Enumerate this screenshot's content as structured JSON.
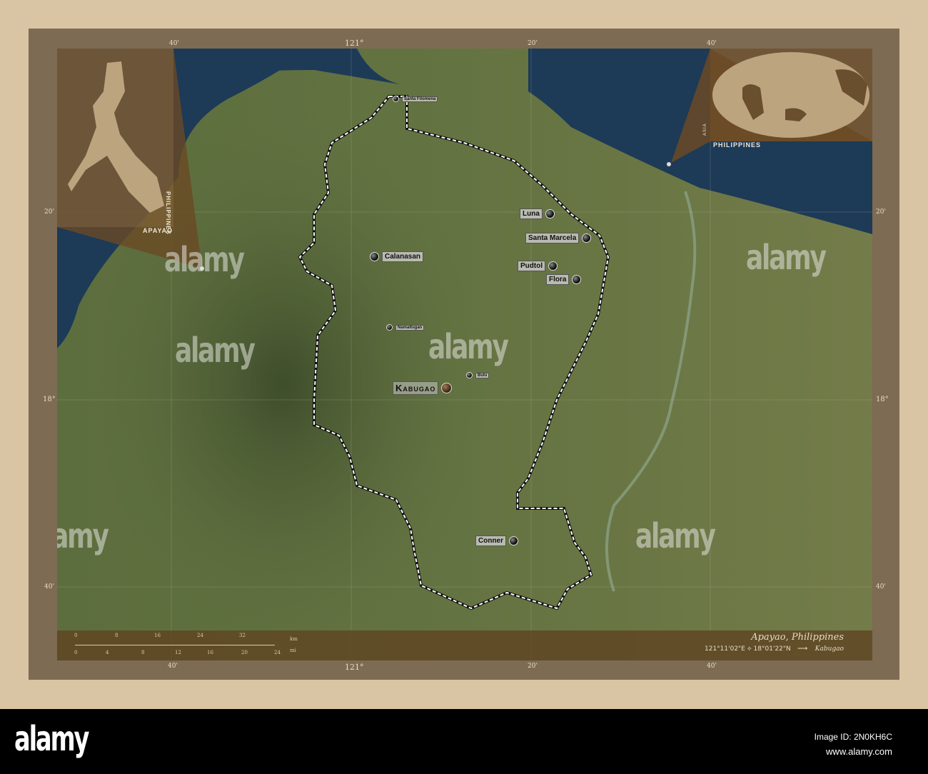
{
  "map": {
    "title": "Apayao, Philippines",
    "capital_coords": "121°11'02\"E ⟡ 18°01'22\"N",
    "arrow": "⟶",
    "capital_name": "Kabugao",
    "grid_ticks": {
      "top": [
        "40'",
        "121°",
        "20'",
        "40'"
      ],
      "bottom": [
        "40'",
        "121°",
        "20'",
        "40'"
      ],
      "left": [
        "20'",
        "18°",
        "40'"
      ],
      "right": [
        "20'",
        "18°",
        "40'"
      ]
    },
    "places": [
      {
        "name": "Santa Filomena",
        "size": "small"
      },
      {
        "name": "Luna",
        "size": "normal"
      },
      {
        "name": "Santa Marcela",
        "size": "normal"
      },
      {
        "name": "Calanasan",
        "size": "normal"
      },
      {
        "name": "Pudtol",
        "size": "normal"
      },
      {
        "name": "Flora",
        "size": "normal"
      },
      {
        "name": "Namaltugan",
        "size": "small"
      },
      {
        "name": "Bulu",
        "size": "small"
      },
      {
        "name": "Kabugao",
        "size": "capital"
      },
      {
        "name": "Conner",
        "size": "normal"
      }
    ],
    "inset_country": {
      "country_label": "Philippines",
      "region_label": "Apayao"
    },
    "inset_world": {
      "country_label": "Philippines",
      "continent_label": "Asia"
    },
    "scale": {
      "km_unit": "km",
      "mi_unit": "mi",
      "km_ticks": [
        "0",
        "8",
        "16",
        "24",
        "32"
      ],
      "mi_ticks": [
        "0",
        "4",
        "8",
        "12",
        "16",
        "20",
        "24"
      ]
    }
  },
  "watermark": {
    "logo": "alamy",
    "letter": "a",
    "image_id": "Image ID: 2N0KH6C",
    "url": "www.alamy.com"
  },
  "colors": {
    "frame": "#7d6b53",
    "page": "#d9c4a3",
    "sea": "#1d3a57",
    "land": "#5d6e3e",
    "legend": "#5f4623"
  }
}
